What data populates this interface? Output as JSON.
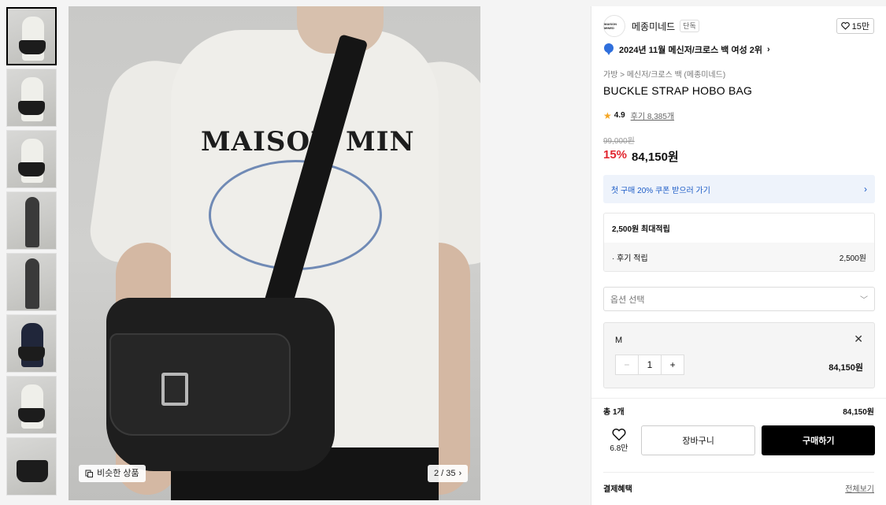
{
  "gallery": {
    "thumbnails": [
      "thumb-1",
      "thumb-2",
      "thumb-3",
      "thumb-4",
      "thumb-5",
      "thumb-6",
      "thumb-7",
      "thumb-8"
    ],
    "active_index": 0,
    "shirt_print": "MAISON MIN",
    "similar_label": "비슷한 상품",
    "pager": "2 / 35"
  },
  "product": {
    "brand": "메종미네드",
    "exclusive_badge": "단독",
    "brand_logo_text": "MAISON MINED",
    "like_count": "15만",
    "ranking": "2024년 11월 메신저/크로스 백 여성 2위",
    "breadcrumb": [
      "가방",
      "메신저/크로스 백 (메종미네드)"
    ],
    "breadcrumb_sep": ">",
    "title": "BUCKLE STRAP HOBO BAG",
    "rating": "4.9",
    "reviews": "후기 8,385개",
    "original_price": "99,000원",
    "discount": "15%",
    "price": "84,150원"
  },
  "coupon": {
    "label": "첫 구매 20% 쿠폰 받으러 가기"
  },
  "points": {
    "title": "2,500원 최대적립",
    "rows": [
      {
        "label": "· 후기 적립",
        "amount": "2,500원"
      }
    ]
  },
  "option": {
    "placeholder": "옵션 선택"
  },
  "selected": {
    "size": "M",
    "quantity": "1",
    "price": "84,150원"
  },
  "summary": {
    "label": "총 1개",
    "total": "84,150원"
  },
  "actions": {
    "wish_count": "6.8만",
    "cart": "장바구니",
    "buy": "구매하기"
  },
  "benefits": {
    "label": "결제혜택",
    "view_all": "전체보기"
  },
  "colors": {
    "discount": "#e2262f",
    "coupon_text": "#1c5cc7",
    "coupon_bg": "#eef3fb",
    "buy_bg": "#000000"
  }
}
